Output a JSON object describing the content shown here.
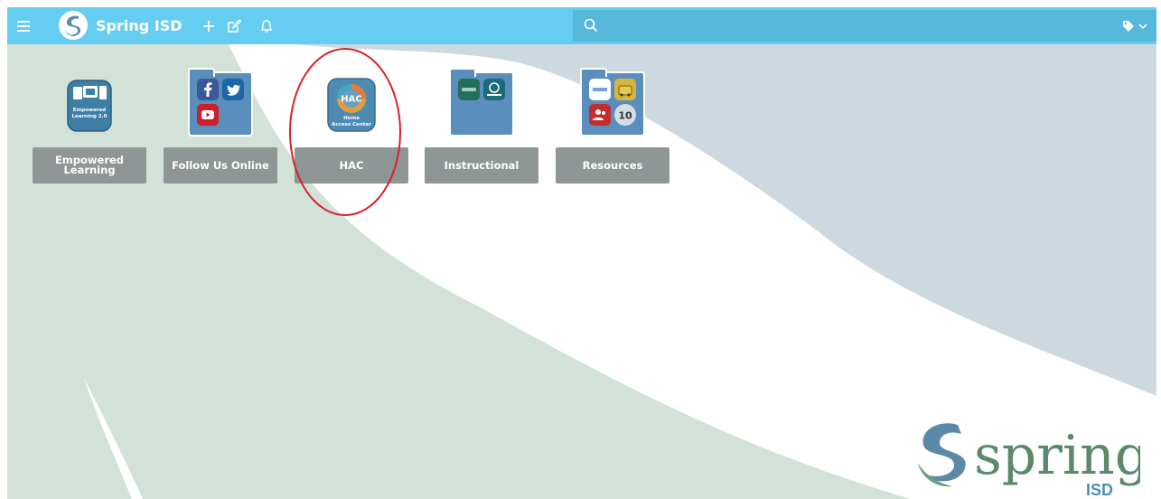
{
  "app": {
    "title": "Spring ISD",
    "search_placeholder": ""
  },
  "icons": {
    "menu": "hamburger-menu-icon",
    "logo": "spring-isd-logo-icon",
    "add": "plus-icon",
    "edit": "edit-icon",
    "notify": "bell-icon",
    "search": "search-icon",
    "tag": "tag-icon",
    "chevron": "chevron-down-icon"
  },
  "tiles": [
    {
      "label_line1": "Empowered",
      "label_line2": "Learning",
      "icon_text1": "Empowered",
      "icon_text2": "Learning 2.0"
    },
    {
      "label": "Follow Us Online"
    },
    {
      "label": "HAC",
      "icon_text1": "Home",
      "icon_text2": "Access Center",
      "badge": "HAC"
    },
    {
      "label": "Instructional"
    },
    {
      "label": "Resources",
      "count": "10"
    }
  ],
  "watermark": {
    "word": "spring",
    "sub": "ISD"
  },
  "colors": {
    "topbar": "#66cdf2",
    "search_bg": "#56b8da",
    "tile_label": "#8f9696",
    "folder": "#5a8fbd",
    "annotation": "#d9202a",
    "logo_green": "#5a8a6a"
  }
}
